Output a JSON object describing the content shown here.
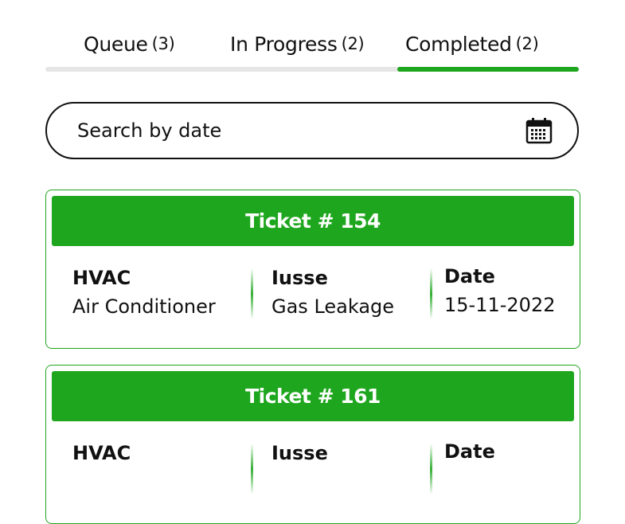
{
  "tabs": [
    {
      "label": "Queue",
      "count": "(3)",
      "active": false
    },
    {
      "label": "In Progress",
      "count": "(2)",
      "active": false
    },
    {
      "label": "Completed",
      "count": "(2)",
      "active": true
    }
  ],
  "search": {
    "placeholder": "Search by date",
    "icon": "calendar-icon"
  },
  "columns": {
    "category_label": "HVAC",
    "issue_label": "Iusse",
    "date_label": "Date"
  },
  "tickets": [
    {
      "title": "Ticket # 154",
      "category": "Air Conditioner",
      "issue": "Gas Leakage",
      "date": "15-11-2022"
    },
    {
      "title": "Ticket # 161",
      "category": "",
      "issue": "",
      "date": ""
    }
  ],
  "colors": {
    "accent": "#1ea61e",
    "track": "#e6e6e6",
    "text": "#111111"
  }
}
